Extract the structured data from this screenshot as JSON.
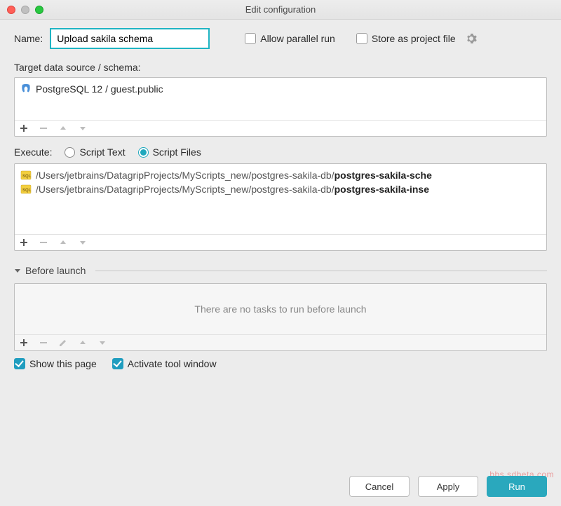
{
  "window": {
    "title": "Edit configuration"
  },
  "name": {
    "label": "Name:",
    "value": "Upload sakila schema"
  },
  "parallel": {
    "label": "Allow parallel run",
    "checked": false
  },
  "storeProject": {
    "label": "Store as project file",
    "checked": false
  },
  "target": {
    "label": "Target data source / schema:",
    "items": [
      "PostgreSQL 12 / guest.public"
    ]
  },
  "execute": {
    "label": "Execute:",
    "options": {
      "text": "Script Text",
      "files": "Script Files"
    },
    "selected": "files"
  },
  "scripts": {
    "items": [
      {
        "dir": "/Users/jetbrains/DatagripProjects/MyScripts_new/postgres-sakila-db/",
        "file": "postgres-sakila-sche"
      },
      {
        "dir": "/Users/jetbrains/DatagripProjects/MyScripts_new/postgres-sakila-db/",
        "file": "postgres-sakila-inse"
      }
    ]
  },
  "beforeLaunch": {
    "label": "Before launch",
    "empty": "There are no tasks to run before launch"
  },
  "checks": {
    "showPage": {
      "label": "Show this page",
      "checked": true
    },
    "activateTool": {
      "label": "Activate tool window",
      "checked": true
    }
  },
  "buttons": {
    "cancel": "Cancel",
    "apply": "Apply",
    "run": "Run"
  },
  "watermark": "bbs.sdbeta.com"
}
